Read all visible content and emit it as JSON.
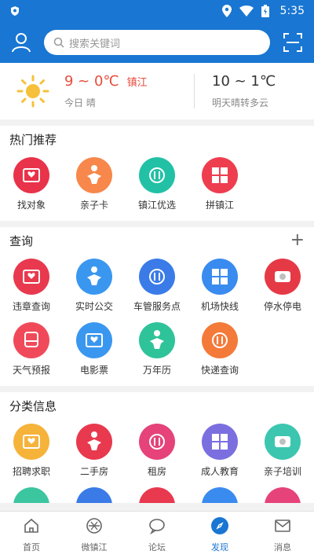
{
  "status": {
    "time": "5:35"
  },
  "header": {
    "search_placeholder": "搜索关键词"
  },
  "weather": {
    "today_temp": "9 ~ 0℃",
    "city": "镇江",
    "today_desc": "今日 晴",
    "tomorrow_temp": "10 ~ 1℃",
    "tomorrow_desc": "明天晴转多云"
  },
  "hot": {
    "title": "热门推荐",
    "items": [
      {
        "label": "找对象",
        "color": "#e8334a"
      },
      {
        "label": "亲子卡",
        "color": "#f7874b"
      },
      {
        "label": "镇江优选",
        "color": "#22c1a6"
      },
      {
        "label": "拼镇江",
        "color": "#ee3d4f"
      }
    ]
  },
  "query": {
    "title": "查询",
    "add_label": "+",
    "items": [
      {
        "label": "违章查询",
        "color": "#e8394f"
      },
      {
        "label": "实时公交",
        "color": "#3a97f0"
      },
      {
        "label": "车管服务点",
        "color": "#3a7be8"
      },
      {
        "label": "机场快线",
        "color": "#3a8bef"
      },
      {
        "label": "停水停电",
        "color": "#e53a45"
      },
      {
        "label": "天气预报",
        "color": "#f04a5a"
      },
      {
        "label": "电影票",
        "color": "#3a97f0"
      },
      {
        "label": "万年历",
        "color": "#2fc39a"
      },
      {
        "label": "快递查询",
        "color": "#f47a3a"
      }
    ]
  },
  "category": {
    "title": "分类信息",
    "items": [
      {
        "label": "招聘求职",
        "color": "#f6b33a"
      },
      {
        "label": "二手房",
        "color": "#e8394f"
      },
      {
        "label": "租房",
        "color": "#e5437a"
      },
      {
        "label": "成人教育",
        "color": "#7b6fe0"
      },
      {
        "label": "亲子培训",
        "color": "#3cc6b0"
      }
    ],
    "partial_colors": [
      "#3cc6a0",
      "#3a7be8",
      "#e8394f",
      "#3a8bef",
      "#e5437a"
    ]
  },
  "nav": [
    {
      "label": "首页",
      "icon": "home-icon"
    },
    {
      "label": "微镇江",
      "icon": "aperture-icon"
    },
    {
      "label": "论坛",
      "icon": "chat-icon"
    },
    {
      "label": "发现",
      "icon": "compass-icon",
      "active": true
    },
    {
      "label": "消息",
      "icon": "mail-icon"
    }
  ]
}
